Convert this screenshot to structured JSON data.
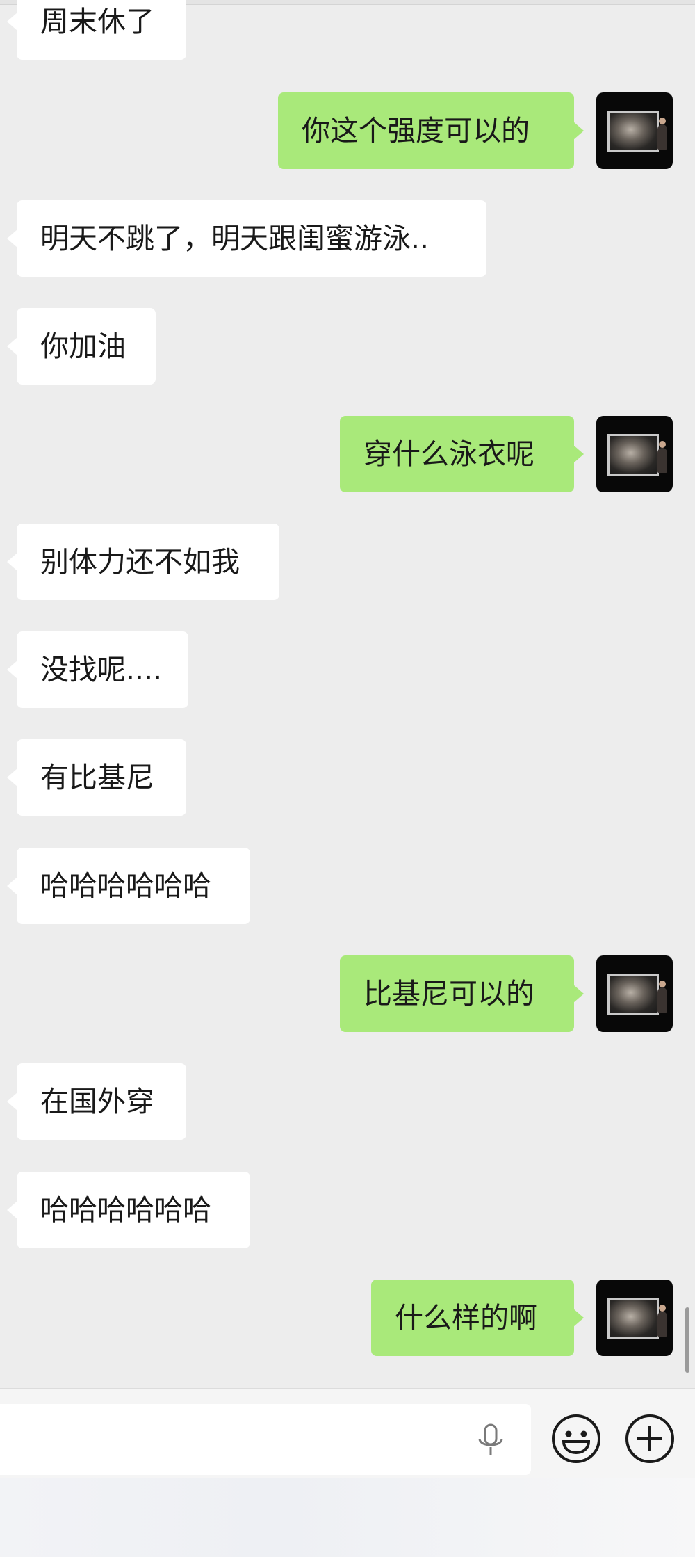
{
  "chat": {
    "messages": [
      {
        "side": "in",
        "text": "周末休了"
      },
      {
        "side": "out",
        "text": "你这个强度可以的"
      },
      {
        "side": "in",
        "text": "明天不跳了，明天跟闺蜜游泳.."
      },
      {
        "side": "in",
        "text": "你加油"
      },
      {
        "side": "out",
        "text": "穿什么泳衣呢"
      },
      {
        "side": "in",
        "text": "别体力还不如我"
      },
      {
        "side": "in",
        "text": "没找呢...."
      },
      {
        "side": "in",
        "text": "有比基尼"
      },
      {
        "side": "in",
        "text": "哈哈哈哈哈哈"
      },
      {
        "side": "out",
        "text": "比基尼可以的"
      },
      {
        "side": "in",
        "text": "在国外穿"
      },
      {
        "side": "in",
        "text": "哈哈哈哈哈哈"
      },
      {
        "side": "out",
        "text": "什么样的啊"
      }
    ]
  },
  "input": {
    "value": "",
    "placeholder": ""
  },
  "icons": {
    "voice": "mic-icon",
    "emoji": "emoji-icon",
    "more": "plus-icon"
  },
  "colors": {
    "background": "#ededed",
    "outgoing_bubble": "#a9e97a",
    "incoming_bubble": "#ffffff",
    "text": "#191919"
  }
}
